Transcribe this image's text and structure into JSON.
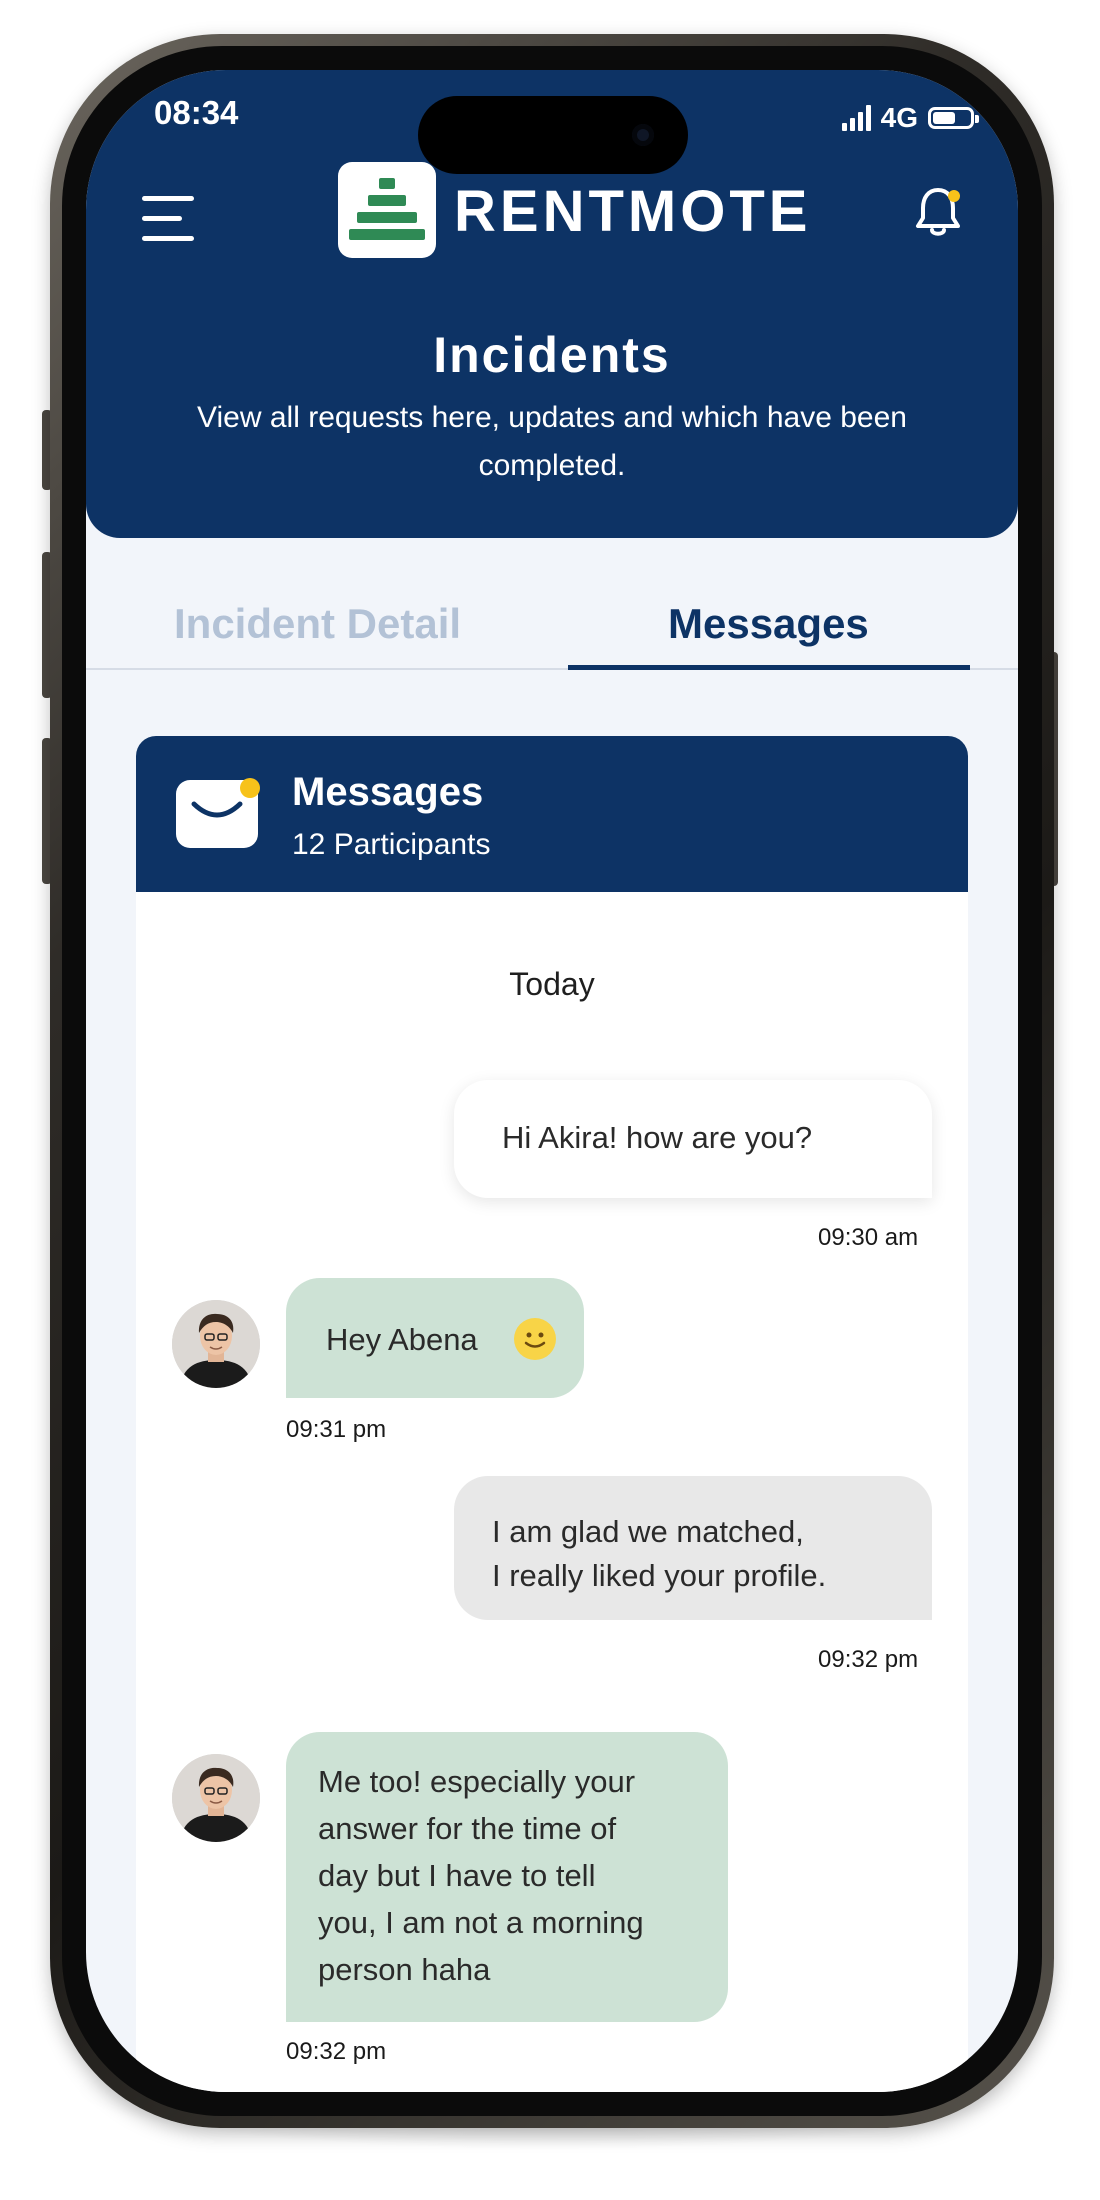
{
  "status_bar": {
    "time": "08:34",
    "network": "4G"
  },
  "header": {
    "brand": "RENTMOTE",
    "title": "Incidents",
    "subtitle": "View all requests here, updates and which have been completed."
  },
  "tabs": [
    {
      "label": "Incident Detail",
      "active": false
    },
    {
      "label": "Messages",
      "active": true
    }
  ],
  "messages_card": {
    "title": "Messages",
    "participants": "12 Participants",
    "day_label": "Today",
    "messages": [
      {
        "direction": "outgoing",
        "text": "Hi Akira! how are you?",
        "time": "09:30 am"
      },
      {
        "direction": "incoming",
        "text": "Hey Abena",
        "emoji": "slightly-smiling-face-icon",
        "time": "09:31 pm"
      },
      {
        "direction": "outgoing",
        "lines": [
          "I am glad we matched,",
          "I really liked your profile."
        ],
        "time": "09:32 pm"
      },
      {
        "direction": "incoming",
        "lines": [
          "Me too! especially your",
          "answer for the time of",
          "day but I have to tell",
          "you, I am not a morning",
          "person haha"
        ],
        "time": "09:32 pm"
      }
    ]
  },
  "colors": {
    "primary": "#0d3365",
    "incoming_bubble": "#cde2d5",
    "outgoing_bubble_alt": "#e8e8e8",
    "accent_dot": "#f7c21a",
    "logo_green": "#2f8a55",
    "inactive_tab": "#b3c2d6"
  }
}
